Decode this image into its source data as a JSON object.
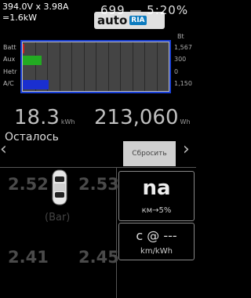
{
  "header": {
    "power_line1": "394.0V x 3.98A",
    "power_line2": "=1.6kW",
    "top_right": "699 — 5:20%"
  },
  "watermark": {
    "auto": "auto",
    "ria": "RIA"
  },
  "bar_chart": {
    "unit_label": "Bt",
    "rows": [
      {
        "name": "Batt",
        "value": "1,567",
        "fraction": 0.01,
        "color": "#cc2222"
      },
      {
        "name": "Aux",
        "value": "300",
        "fraction": 0.13,
        "color": "#22aa22"
      },
      {
        "name": "Hetr",
        "value": "0",
        "fraction": 0.0,
        "color": "#888888"
      },
      {
        "name": "A/C",
        "value": "1,150",
        "fraction": 0.18,
        "color": "#1a2fd0"
      }
    ]
  },
  "energy": {
    "remaining_value": "18.3",
    "remaining_unit": "kWh",
    "total_value": "213,060",
    "total_unit": "Wh",
    "remaining_label": "Осталось",
    "reset_label": "Сбросить"
  },
  "tires": {
    "front_left": "2.52",
    "front_right": "2.53",
    "rear_left": "2.41",
    "rear_right": "2.45",
    "unit": "(Bar)"
  },
  "panel_top": {
    "value": "na",
    "label": "км→5%"
  },
  "panel_bottom": {
    "value": "c @ ---",
    "label": "km/kWh"
  }
}
